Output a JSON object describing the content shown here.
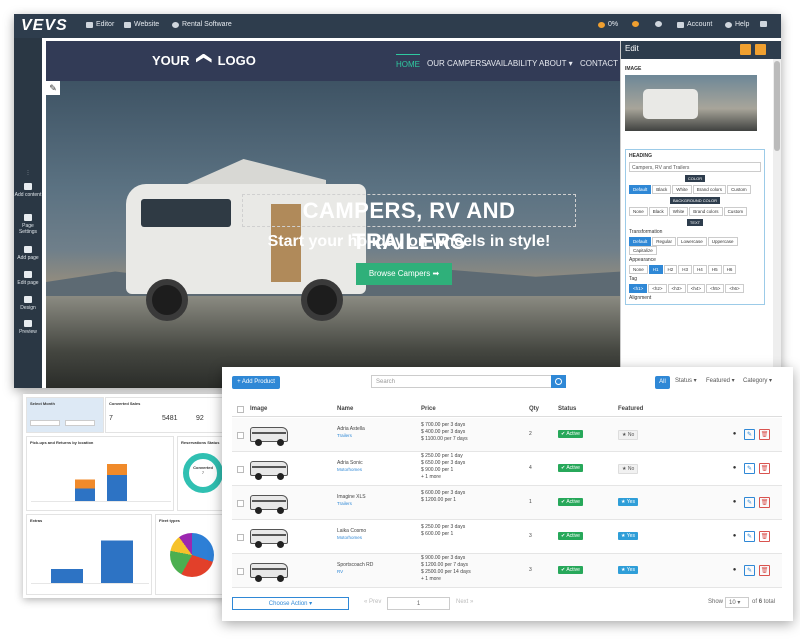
{
  "editor": {
    "logo": "VEVS",
    "topbar": {
      "editor": "Editor",
      "website": "Website",
      "rental": "Rental Software",
      "percent": "0%",
      "account": "Account",
      "help": "Help"
    },
    "leftbar": [
      "Add content",
      "Page Settings",
      "Add page",
      "Edit page",
      "Design",
      "Preview"
    ]
  },
  "site": {
    "logo_text": "YOUR",
    "logo_text2": "LOGO",
    "nav": [
      "HOME",
      "OUR CAMPERS",
      "AVAILABILITY",
      "ABOUT",
      "CONTACT U"
    ],
    "heading": "CAMPERS, RV AND TRAILERS",
    "subheading": "Start your holiday on wheels in style!",
    "cta": "Browse Campers"
  },
  "edit_panel": {
    "title": "Edit",
    "image_label": "IMAGE",
    "heading_label": "HEADING",
    "heading_value": "Campers, RV and Trailers",
    "color_label": "COLOR",
    "color_options": [
      "Default",
      "Black",
      "White",
      "Brand colors",
      "Custom"
    ],
    "bg_color_label": "BACKGROUND COLOR",
    "bg_options": [
      "None",
      "Black",
      "White",
      "Brand colors",
      "Custom"
    ],
    "text_label": "TEXT",
    "transformation_label": "Transformation",
    "transformation_options": [
      "Default",
      "Regular",
      "Lowercase",
      "Uppercase",
      "Capitalize"
    ],
    "appearance_label": "Appearance",
    "appearance_options": [
      "None",
      "H1",
      "H2",
      "H3",
      "H4",
      "H5",
      "H6"
    ],
    "tag_label": "Tag",
    "tag_options": [
      "<h1>",
      "<h2>",
      "<h3>",
      "<h4>",
      "<h5>",
      "<h6>"
    ],
    "alignment_label": "Alignment"
  },
  "dashboard": {
    "select_month": "Select Month",
    "converted_sales": "Converted Sales",
    "stat1": "7",
    "stat2": "5481",
    "stat3": "92",
    "chart1_title": "Pick-ups and Returns by location",
    "chart2_title": "Reservations Status",
    "donut_label": "Converted",
    "donut_value": "7",
    "chart3_title": "Extras",
    "chart4_title": "Fleet types",
    "bar_values": [
      0.0,
      0.25,
      0.52,
      0.0
    ],
    "bar_values_top": [
      0.0,
      0.18,
      0.22,
      0.0
    ],
    "extras_values": [
      0.28,
      0.85
    ]
  },
  "products": {
    "add_button": "+ Add Product",
    "search_placeholder": "Search",
    "filters": {
      "all": "All",
      "status": "Status",
      "featured": "Featured",
      "category": "Category"
    },
    "columns": [
      "Image",
      "Name",
      "Price",
      "Qty",
      "Status",
      "Featured"
    ],
    "rows": [
      {
        "name": "Adria Astella",
        "category": "Trailers",
        "price": [
          "$ 700.00 per 3 days",
          "$ 400.00 per 3 days",
          "$ 1100.00 per 7 days"
        ],
        "qty": "2",
        "status": "Active",
        "featured": "No"
      },
      {
        "name": "Adria Sonic",
        "category": "Motorhomes",
        "price": [
          "$ 250.00 per 1 day",
          "$ 650.00 per 3 days",
          "$ 900.00 per 1",
          "+ 1 more"
        ],
        "qty": "4",
        "status": "Active",
        "featured": "No"
      },
      {
        "name": "Imagine XLS",
        "category": "Trailers",
        "price": [
          "$ 600.00 per 3 days",
          "$ 1200.00 per 1"
        ],
        "qty": "1",
        "status": "Active",
        "featured": "Yes"
      },
      {
        "name": "Laika Cosmo",
        "category": "Motorhomes",
        "price": [
          "$ 250.00 per 3 days",
          "$ 600.00 per 1"
        ],
        "qty": "3",
        "status": "Active",
        "featured": "Yes"
      },
      {
        "name": "Sportscoach RD",
        "category": "RV",
        "price": [
          "$ 900.00 per 3 days",
          "$ 1200.00 per 7 days",
          "$ 2500.00 per 14 days",
          "+ 1 more"
        ],
        "qty": "3",
        "status": "Active",
        "featured": "Yes"
      }
    ],
    "choose_action": "Choose Action",
    "prev": "« Prev",
    "page": "1",
    "next": "Next »",
    "show": "Show",
    "per_page": "10",
    "of": "of",
    "total_pages": "6",
    "total": "total"
  }
}
